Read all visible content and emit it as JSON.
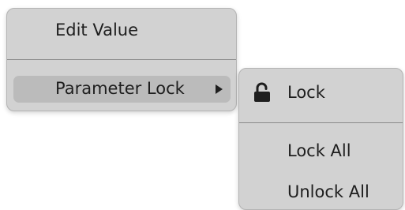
{
  "primary_menu": {
    "edit_value_label": "Edit Value",
    "parameter_lock_label": "Parameter Lock"
  },
  "sub_menu": {
    "lock_label": "Lock",
    "lock_icon": "unlocked-padlock-icon",
    "lock_all_label": "Lock All",
    "unlock_all_label": "Unlock All"
  },
  "colors": {
    "menu_background": "#d2d2d2",
    "highlight": "#bbbbbb",
    "text": "#1e1e1e",
    "separator": "#8a8a8a"
  }
}
